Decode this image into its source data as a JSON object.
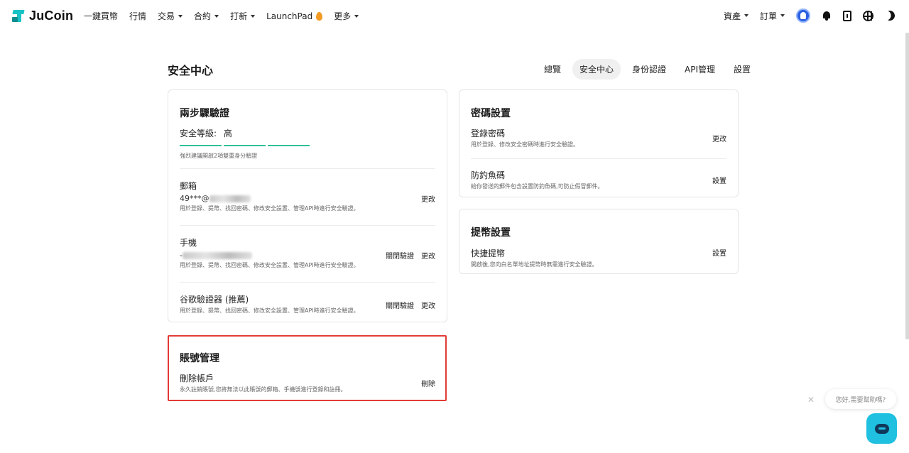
{
  "header": {
    "logo": "JuCoin",
    "nav": [
      {
        "label": "一鍵買幣",
        "dropdown": false
      },
      {
        "label": "行情",
        "dropdown": false
      },
      {
        "label": "交易",
        "dropdown": true
      },
      {
        "label": "合約",
        "dropdown": true
      },
      {
        "label": "打新",
        "dropdown": true
      },
      {
        "label": "LaunchPad",
        "dropdown": false
      },
      {
        "label": "更多",
        "dropdown": true
      }
    ],
    "assets_label": "資產",
    "orders_label": "訂單"
  },
  "page": {
    "title": "安全中心",
    "tabs": [
      "總覽",
      "安全中心",
      "身份認證",
      "API管理",
      "設置"
    ],
    "active_tab": 1
  },
  "two_factor": {
    "title": "兩步驟驗證",
    "level_label": "安全等級:",
    "level_value": "高",
    "recommendation": "強烈建議開啟2項雙重身分驗證",
    "email": {
      "label": "郵箱",
      "value_prefix": "49***@",
      "desc": "用於登錄、提幣、找回密碼、修改安全設置、管理API時進行安全驗證。",
      "action": "更改"
    },
    "phone": {
      "label": "手機",
      "value_prefix": "-",
      "desc": "用於登錄、提幣、找回密碼、修改安全設置、管理API時進行安全驗證。",
      "action_disable": "關閉驗證",
      "action_change": "更改"
    },
    "google": {
      "label": "谷歌驗證器 (推薦)",
      "desc": "用於登錄、提幣、找回密碼、修改安全設置、管理API時進行安全驗證。",
      "action_disable": "關閉驗證",
      "action_change": "更改"
    }
  },
  "account": {
    "title": "賬號管理",
    "delete_label": "刪除帳戶",
    "delete_desc": "永久註銷賬號,您將無法以此賬號的郵箱、手機號進行登錄和註冊。",
    "delete_action": "刪除"
  },
  "password": {
    "title": "密碼設置",
    "login": {
      "label": "登錄密碼",
      "desc": "用於登錄、修改安全密碼時進行安全驗證。",
      "action": "更改"
    },
    "anti_phishing": {
      "label": "防釣魚碼",
      "desc": "給你發送的郵件包含設置防釣魚碼,可防止假冒郵件。",
      "action": "設置"
    }
  },
  "withdraw": {
    "title": "提幣設置",
    "quick": {
      "label": "快捷提幣",
      "desc": "開啟後,您向白名單地址提幣時無需進行安全驗證。",
      "action": "設置"
    }
  },
  "chat": {
    "greeting": "您好,需要幫助嗎?"
  },
  "colors": {
    "accent": "#19c3c5",
    "level_bar": "#2dc09a",
    "danger_border": "#e23b35",
    "chat": "#1fc0e0"
  }
}
